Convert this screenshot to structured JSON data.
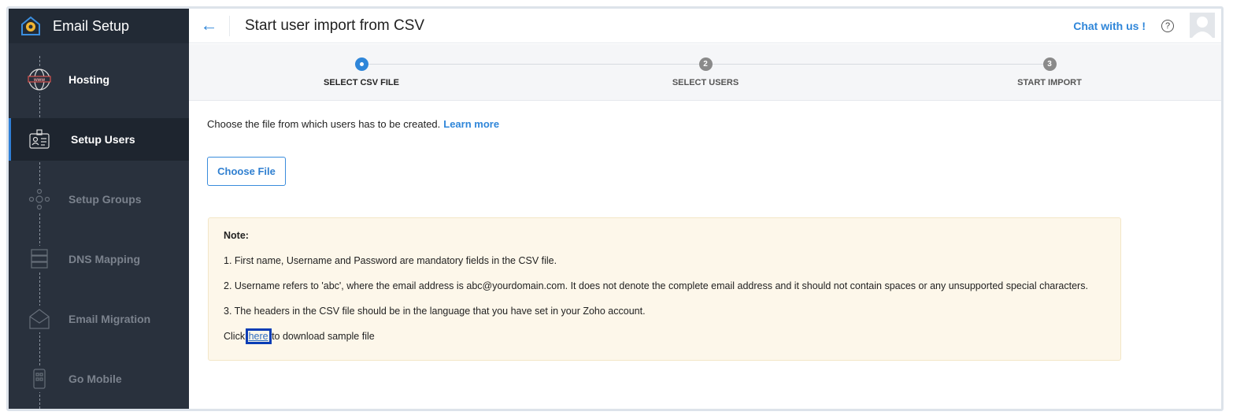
{
  "sidebar": {
    "app_title": "Email Setup",
    "items": [
      {
        "label": "Hosting",
        "icon": "globe-www-icon",
        "state": "done"
      },
      {
        "label": "Setup Users",
        "icon": "id-card-icon",
        "state": "active"
      },
      {
        "label": "Setup Groups",
        "icon": "group-icon",
        "state": "pending"
      },
      {
        "label": "DNS Mapping",
        "icon": "server-icon",
        "state": "pending"
      },
      {
        "label": "Email Migration",
        "icon": "envelope-icon",
        "state": "pending"
      },
      {
        "label": "Go Mobile",
        "icon": "mobile-icon",
        "state": "pending"
      }
    ]
  },
  "header": {
    "title": "Start user import from CSV",
    "chat": "Chat with us !",
    "help": "?"
  },
  "stepper": {
    "steps": [
      {
        "num": "1",
        "label": "SELECT CSV FILE"
      },
      {
        "num": "2",
        "label": "SELECT USERS"
      },
      {
        "num": "3",
        "label": "START IMPORT"
      }
    ],
    "current": 1
  },
  "content": {
    "intro": "Choose the file from which users has to be created.",
    "learn_more": "Learn more",
    "choose_file": "Choose File",
    "note": {
      "title": "Note:",
      "items": [
        "1. First name, Username and Password are mandatory fields in the CSV file.",
        "2. Username refers to 'abc', where the email address is abc@yourdomain.com. It does not denote the complete email address and it should not contain spaces or any unsupported special characters.",
        "3. The headers in the CSV file should be in the language that you have set in your Zoho account."
      ],
      "click_prefix": "Click ",
      "here": "here",
      "click_suffix": " to download sample file"
    }
  },
  "colors": {
    "accent": "#2f86d9",
    "sidebar": "#29313d",
    "note_bg": "#fdf7ea"
  }
}
